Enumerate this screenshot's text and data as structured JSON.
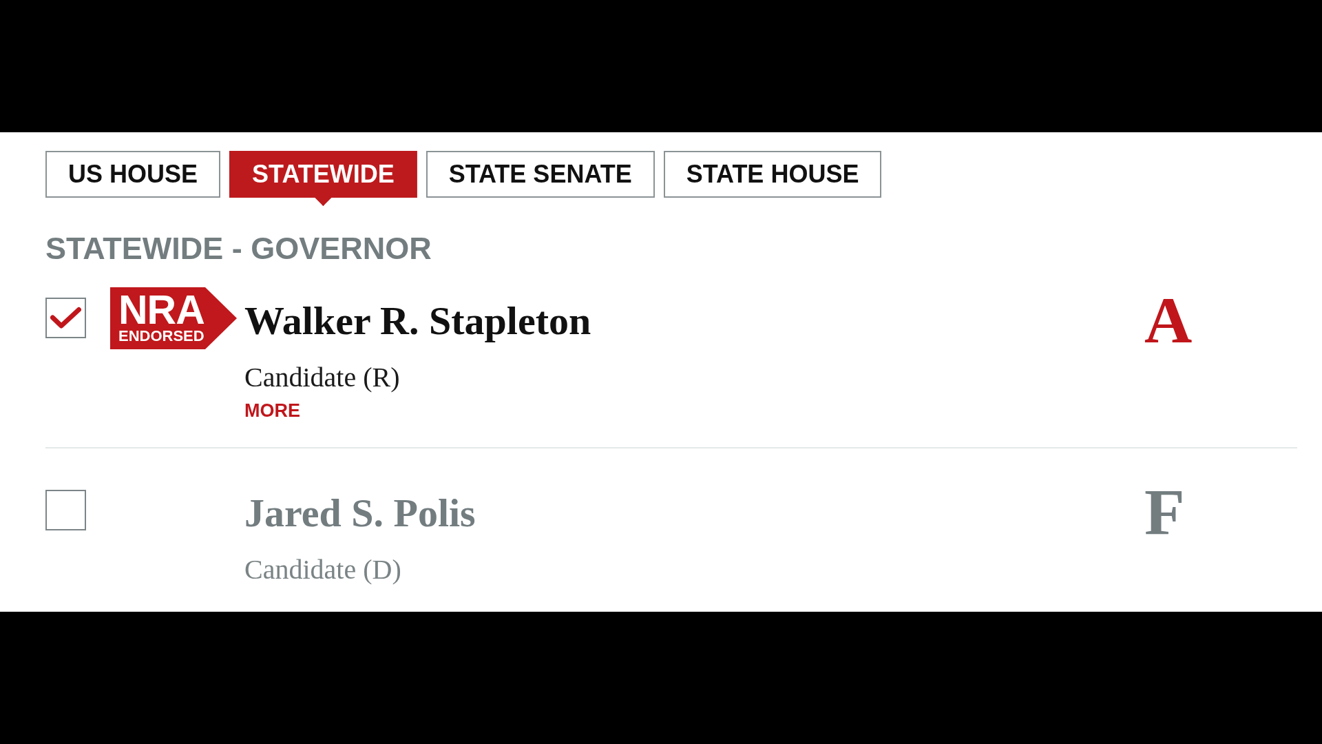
{
  "tabs": [
    {
      "label": "US HOUSE",
      "selected": false
    },
    {
      "label": "STATEWIDE",
      "selected": true
    },
    {
      "label": "STATE SENATE",
      "selected": false
    },
    {
      "label": "STATE HOUSE",
      "selected": false
    }
  ],
  "section_heading": "STATEWIDE - GOVERNOR",
  "candidates": [
    {
      "checked": true,
      "badge": {
        "line_1": "NRA",
        "line_2": "ENDORSED"
      },
      "name": "Walker R. Stapleton",
      "subtitle": "Candidate (R)",
      "more_link": "MORE",
      "grade": "A",
      "dimmed": false
    },
    {
      "checked": false,
      "name": "Jared S. Polis",
      "subtitle": "Candidate (D)",
      "grade": "F",
      "dimmed": true
    }
  ]
}
